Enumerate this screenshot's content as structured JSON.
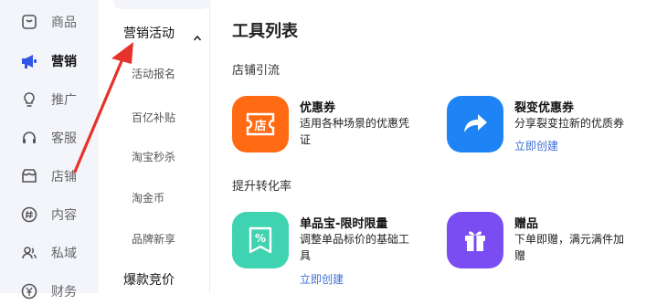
{
  "rail": {
    "items": [
      {
        "label": "商品",
        "icon": "product-icon"
      },
      {
        "label": "营销",
        "icon": "megaphone-icon"
      },
      {
        "label": "推广",
        "icon": "bulb-icon"
      },
      {
        "label": "客服",
        "icon": "headset-icon"
      },
      {
        "label": "店铺",
        "icon": "store-icon"
      },
      {
        "label": "内容",
        "icon": "hash-icon"
      },
      {
        "label": "私域",
        "icon": "people-icon"
      },
      {
        "label": "财务",
        "icon": "yen-icon"
      }
    ],
    "active": "营销"
  },
  "submenu": {
    "group_label": "营销活动",
    "items": [
      "活动报名",
      "百亿补贴",
      "淘宝秒杀",
      "淘金币",
      "品牌新享"
    ],
    "next_group_label": "爆款竞价"
  },
  "main": {
    "title": "工具列表",
    "sections": [
      {
        "title": "店铺引流",
        "tools": [
          {
            "name": "优惠券",
            "desc": "适用各种场景的优惠凭证",
            "cta": "",
            "tile_color": "#ff6a13",
            "icon": "coupon-store-icon",
            "icon_text": "店"
          },
          {
            "name": "裂变优惠券",
            "desc": "分享裂变拉新的优质券",
            "cta": "立即创建",
            "tile_color": "#1e84f5",
            "icon": "share-arrow-icon"
          }
        ]
      },
      {
        "title": "提升转化率",
        "tools": [
          {
            "name": "单品宝-限时限量",
            "desc": "调整单品标价的基础工具",
            "cta": "立即创建",
            "tile_color": "#3fd3b1",
            "icon": "discount-tag-icon",
            "icon_text": "%"
          },
          {
            "name": "赠品",
            "desc": "下单即赠，满元满件加赠",
            "cta": "",
            "tile_color": "#7a4df2",
            "icon": "gift-icon"
          }
        ]
      }
    ]
  }
}
